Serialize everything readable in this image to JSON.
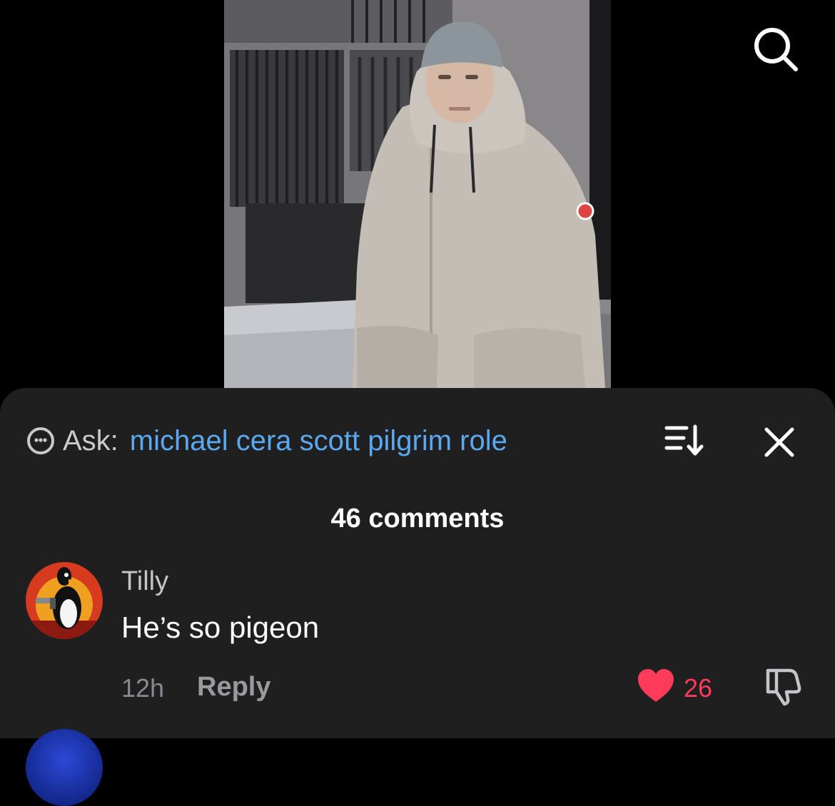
{
  "video": {
    "icon": "video-still-person-in-parka"
  },
  "header": {
    "search_icon": "search-icon"
  },
  "comments_sheet": {
    "ask": {
      "icon": "assistant-face-icon",
      "label": "Ask:",
      "query": "michael cera scott pilgrim role"
    },
    "sort_icon": "sort-icon",
    "close_icon": "close-icon",
    "count_label": "46 comments",
    "comments": [
      {
        "username": "Tilly",
        "text": "He’s so pigeon",
        "time": "12h",
        "reply_label": "Reply",
        "likes": "26",
        "liked": true,
        "avatar_icon": "penguin-avatar"
      }
    ]
  },
  "colors": {
    "background": "#000000",
    "sheet": "#1f1f20",
    "link": "#5aa9f0",
    "like": "#ff3b5c"
  }
}
